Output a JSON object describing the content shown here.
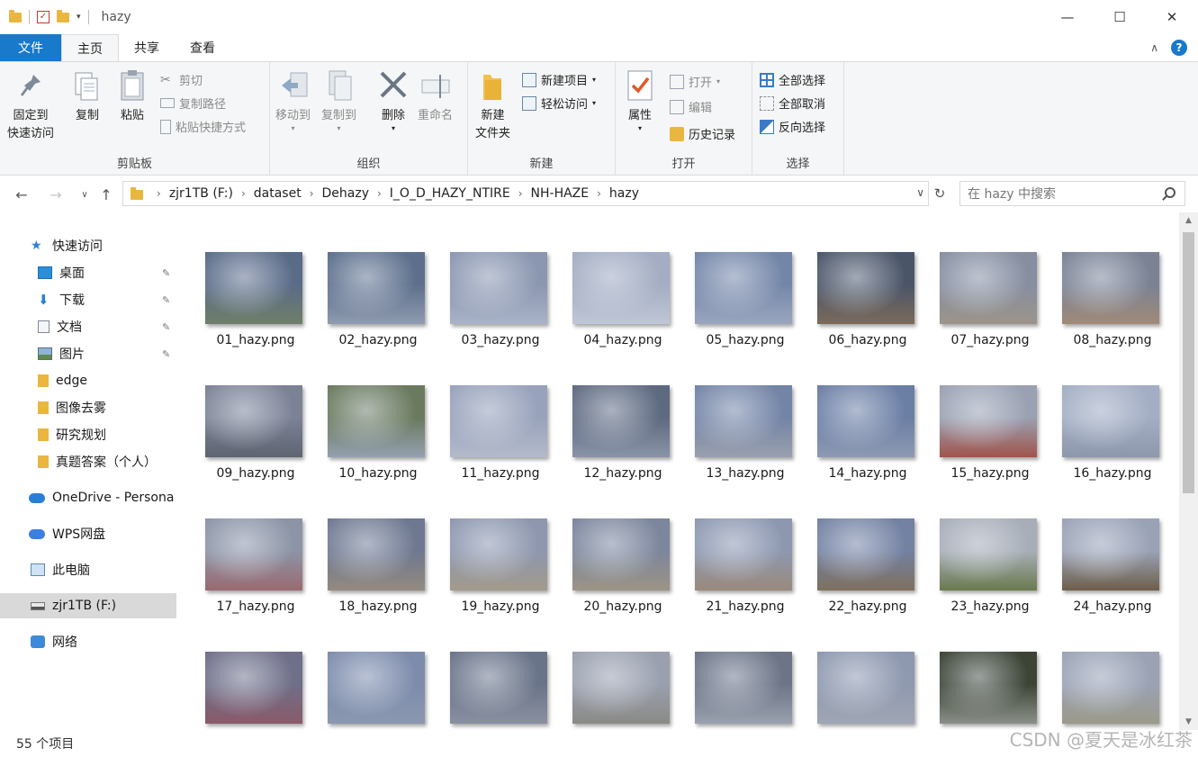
{
  "window": {
    "title": "hazy",
    "minimize": "—",
    "maximize": "☐",
    "close": "✕"
  },
  "tabs": {
    "file": "文件",
    "home": "主页",
    "share": "共享",
    "view": "查看"
  },
  "ribbon": {
    "clipboard": {
      "label": "剪贴板",
      "pin": "固定到",
      "pin2": "快速访问",
      "copy": "复制",
      "paste": "粘贴",
      "cut": "剪切",
      "copy_path": "复制路径",
      "paste_shortcut": "粘贴快捷方式"
    },
    "organize": {
      "label": "组织",
      "move_to": "移动到",
      "copy_to": "复制到",
      "delete": "删除",
      "rename": "重命名"
    },
    "new": {
      "label": "新建",
      "new_folder": "新建",
      "new_folder2": "文件夹",
      "new_item": "新建项目",
      "easy_access": "轻松访问"
    },
    "open": {
      "label": "打开",
      "properties": "属性",
      "open": "打开",
      "edit": "编辑",
      "history": "历史记录"
    },
    "select": {
      "label": "选择",
      "select_all": "全部选择",
      "select_none": "全部取消",
      "invert": "反向选择"
    }
  },
  "address": {
    "crumbs": [
      "zjr1TB (F:)",
      "dataset",
      "Dehazy",
      "I_O_D_HAZY_NTIRE",
      "NH-HAZE",
      "hazy"
    ],
    "search_placeholder": "在 hazy 中搜索"
  },
  "nav": {
    "quick_access": "快速访问",
    "desktop": "桌面",
    "downloads": "下载",
    "documents": "文档",
    "pictures": "图片",
    "edge": "edge",
    "dehaze": "图像去雾",
    "research": "研究规划",
    "answers": "真题答案（个人）",
    "onedrive": "OneDrive - Persona",
    "wps": "WPS网盘",
    "this_pc": "此电脑",
    "drive": "zjr1TB (F:)",
    "network": "网络"
  },
  "files": [
    {
      "name": "01_hazy.png",
      "c1": "#5a6b88",
      "c2": "#6f7f6a"
    },
    {
      "name": "02_hazy.png",
      "c1": "#5d6f8c",
      "c2": "#8f9bb0"
    },
    {
      "name": "03_hazy.png",
      "c1": "#8b97b0",
      "c2": "#a9b2c7"
    },
    {
      "name": "04_hazy.png",
      "c1": "#a4adc3",
      "c2": "#bfc6d6"
    },
    {
      "name": "05_hazy.png",
      "c1": "#7486a8",
      "c2": "#9aa6bf"
    },
    {
      "name": "06_hazy.png",
      "c1": "#4a5568",
      "c2": "#7b6a5a"
    },
    {
      "name": "07_hazy.png",
      "c1": "#868ea0",
      "c2": "#9c948a"
    },
    {
      "name": "08_hazy.png",
      "c1": "#7a8294",
      "c2": "#a08a78"
    },
    {
      "name": "09_hazy.png",
      "c1": "#7c8296",
      "c2": "#5f6472"
    },
    {
      "name": "10_hazy.png",
      "c1": "#6a7a5e",
      "c2": "#94a0b0"
    },
    {
      "name": "11_hazy.png",
      "c1": "#98a2ba",
      "c2": "#b3bacb"
    },
    {
      "name": "12_hazy.png",
      "c1": "#5e6a80",
      "c2": "#8a94a8"
    },
    {
      "name": "13_hazy.png",
      "c1": "#7384a6",
      "c2": "#9aa0ae"
    },
    {
      "name": "14_hazy.png",
      "c1": "#6b7ea4",
      "c2": "#8e9ab4"
    },
    {
      "name": "15_hazy.png",
      "c1": "#9aa1b2",
      "c2": "#a0544a"
    },
    {
      "name": "16_hazy.png",
      "c1": "#a3aec4",
      "c2": "#8d98ac"
    },
    {
      "name": "17_hazy.png",
      "c1": "#8c94a6",
      "c2": "#9a6a70"
    },
    {
      "name": "18_hazy.png",
      "c1": "#6e7890",
      "c2": "#948a80"
    },
    {
      "name": "19_hazy.png",
      "c1": "#8e97ae",
      "c2": "#a29a8c"
    },
    {
      "name": "20_hazy.png",
      "c1": "#7c869c",
      "c2": "#9c9486"
    },
    {
      "name": "21_hazy.png",
      "c1": "#8d98b0",
      "c2": "#9a8a7c"
    },
    {
      "name": "22_hazy.png",
      "c1": "#7381a2",
      "c2": "#7e705e"
    },
    {
      "name": "23_hazy.png",
      "c1": "#a8aeb8",
      "c2": "#6a7a4e"
    },
    {
      "name": "24_hazy.png",
      "c1": "#9aa2b6",
      "c2": "#6e5e4a"
    },
    {
      "name": "",
      "c1": "#6e6f88",
      "c2": "#8a5a6a"
    },
    {
      "name": "",
      "c1": "#7d8cac",
      "c2": "#8a98b0"
    },
    {
      "name": "",
      "c1": "#6a7488",
      "c2": "#8a90a0"
    },
    {
      "name": "",
      "c1": "#9aa0ae",
      "c2": "#8a8a86"
    },
    {
      "name": "",
      "c1": "#6c7486",
      "c2": "#9aa0ae"
    },
    {
      "name": "",
      "c1": "#8e98ae",
      "c2": "#a0a6b4"
    },
    {
      "name": "",
      "c1": "#3c4436",
      "c2": "#8a9088"
    },
    {
      "name": "",
      "c1": "#9aa2b4",
      "c2": "#9c9a8a"
    }
  ],
  "status": {
    "count": "55 个项目",
    "watermark": "CSDN @夏天是冰红茶"
  }
}
